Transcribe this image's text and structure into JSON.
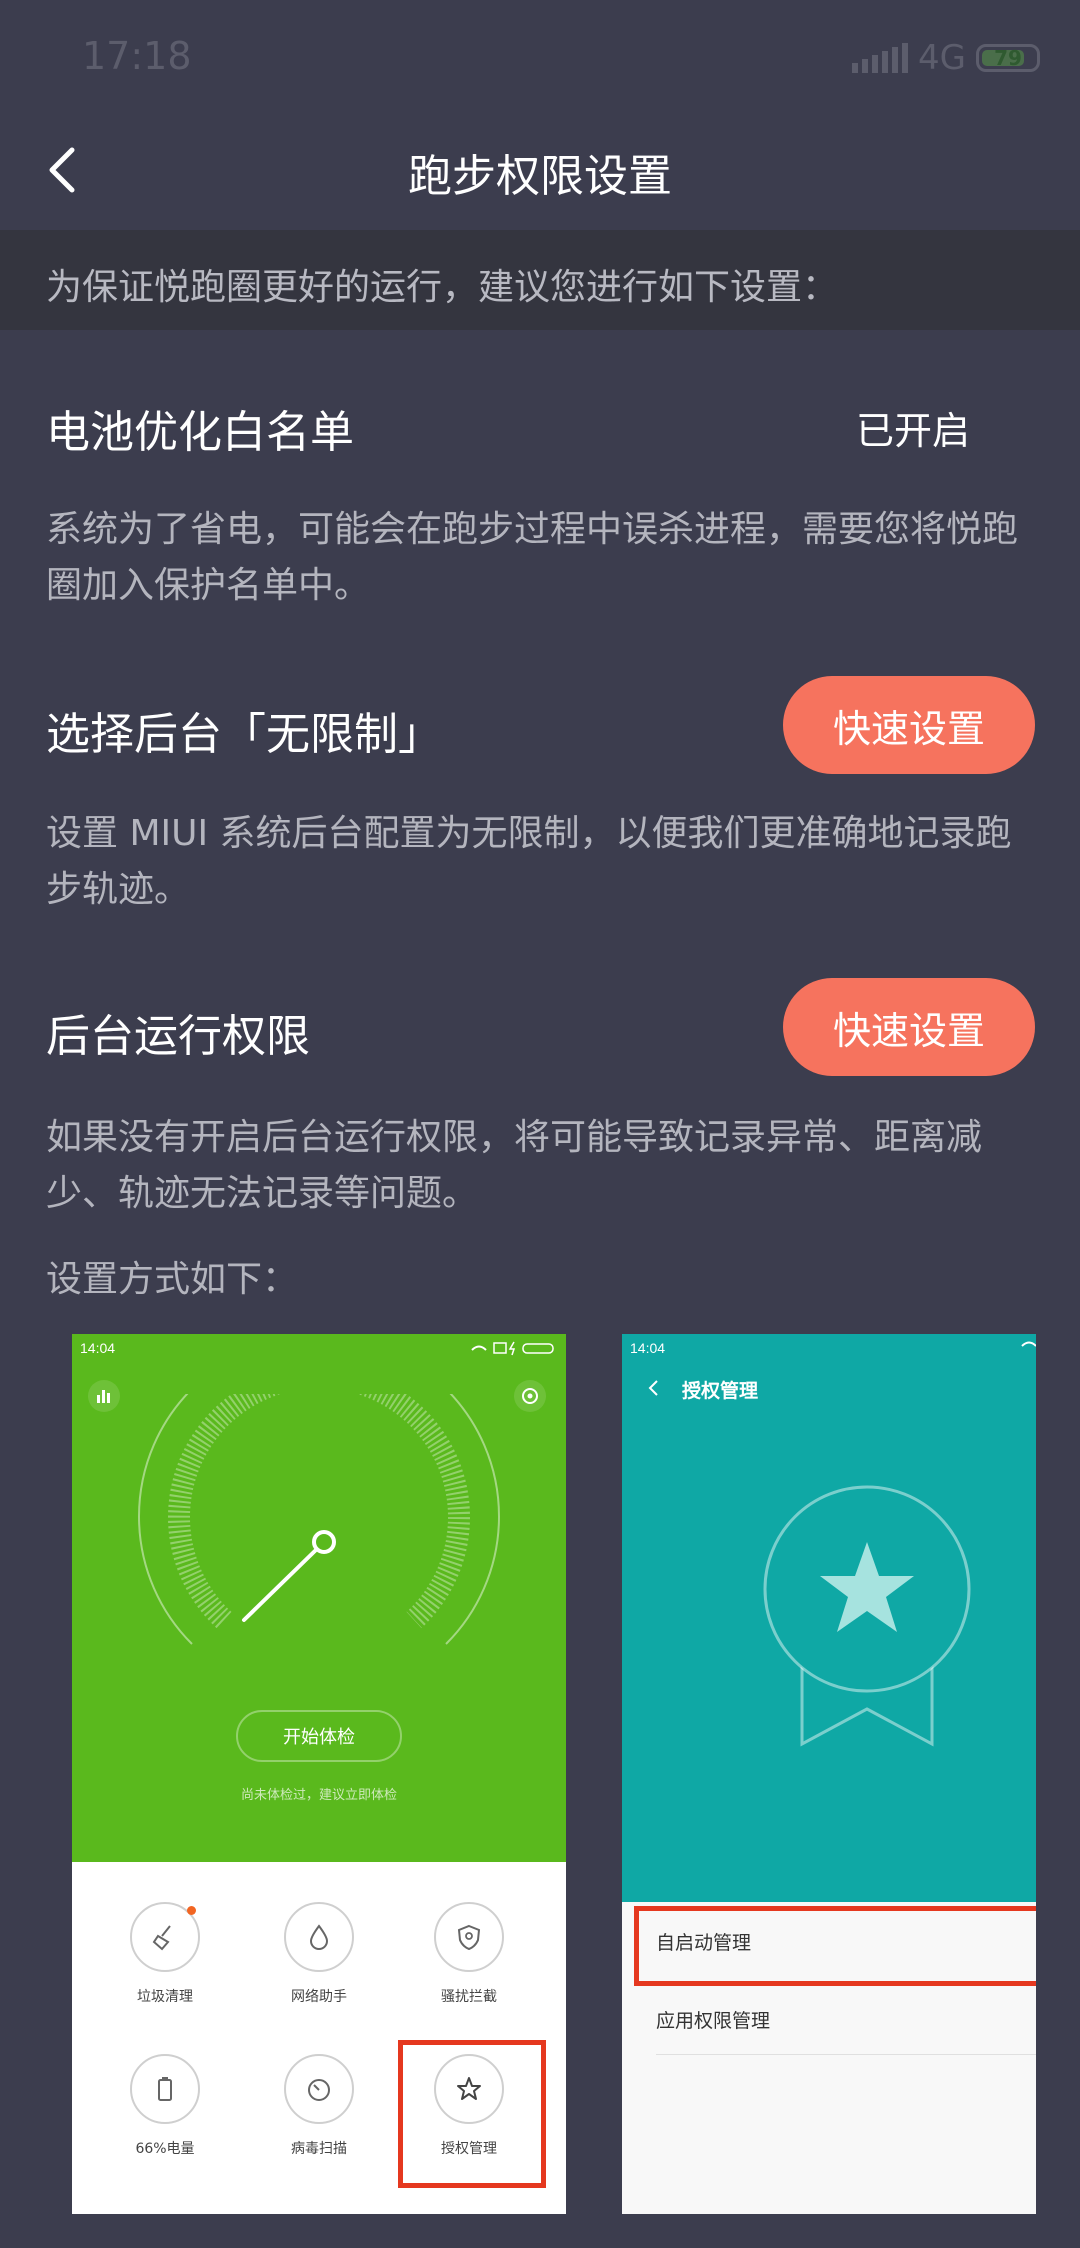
{
  "status_bar": {
    "time": "17:18",
    "network": "4G",
    "battery": "79"
  },
  "header": {
    "title": "跑步权限设置"
  },
  "banner": {
    "text": "为保证悦跑圈更好的运行，建议您进行如下设置："
  },
  "sections": [
    {
      "title": "电池优化白名单",
      "status": "已开启",
      "desc": "系统为了省电，可能会在跑步过程中误杀进程，需要您将悦跑圈加入保护名单中。"
    },
    {
      "title": "选择后台「无限制」",
      "button": "快速设置",
      "desc": "设置 MIUI 系统后台配置为无限制，以便我们更准确地记录跑步轨迹。"
    },
    {
      "title": "后台运行权限",
      "button": "快速设置",
      "desc": "如果没有开启后台运行权限，将可能导致记录异常、距离减少、轨迹无法记录等问题。"
    }
  ],
  "instructions": "设置方式如下：",
  "screenshot1": {
    "time": "14:04",
    "check_button": "开始体检",
    "check_note": "尚未体检过，建议立即体检",
    "tools": [
      "垃圾清理",
      "网络助手",
      "骚扰拦截",
      "66%电量",
      "病毒扫描",
      "授权管理"
    ]
  },
  "screenshot2": {
    "time": "14:04",
    "title": "授权管理",
    "items": [
      "自启动管理",
      "应用权限管理"
    ]
  },
  "colors": {
    "background": "#3c3d4e",
    "accent": "#f6735e",
    "green": "#5ab91d",
    "teal": "#0fa8a5",
    "highlight": "#e5381f"
  }
}
